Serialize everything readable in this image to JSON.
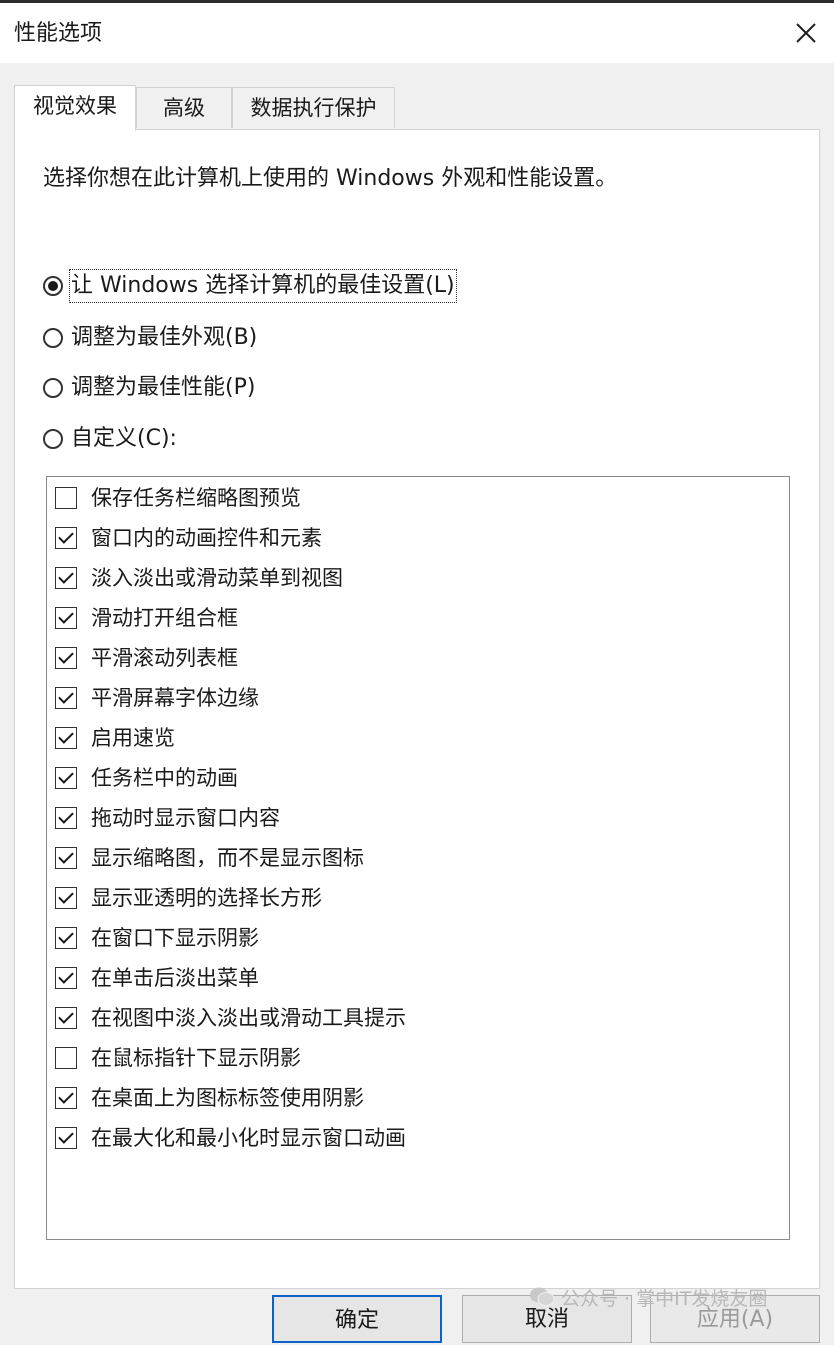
{
  "window": {
    "title": "性能选项"
  },
  "tabs": [
    {
      "label": "视觉效果",
      "active": true
    },
    {
      "label": "高级",
      "active": false
    },
    {
      "label": "数据执行保护",
      "active": false
    }
  ],
  "panel": {
    "instruction": "选择你想在此计算机上使用的 Windows 外观和性能设置。",
    "radios": [
      {
        "label": "让 Windows 选择计算机的最佳设置(L)",
        "selected": true
      },
      {
        "label": "调整为最佳外观(B)",
        "selected": false
      },
      {
        "label": "调整为最佳性能(P)",
        "selected": false
      },
      {
        "label": "自定义(C):",
        "selected": false
      }
    ],
    "options": [
      {
        "label": "保存任务栏缩略图预览",
        "checked": false
      },
      {
        "label": "窗口内的动画控件和元素",
        "checked": true
      },
      {
        "label": "淡入淡出或滑动菜单到视图",
        "checked": true
      },
      {
        "label": "滑动打开组合框",
        "checked": true
      },
      {
        "label": "平滑滚动列表框",
        "checked": true
      },
      {
        "label": "平滑屏幕字体边缘",
        "checked": true
      },
      {
        "label": "启用速览",
        "checked": true
      },
      {
        "label": "任务栏中的动画",
        "checked": true
      },
      {
        "label": "拖动时显示窗口内容",
        "checked": true
      },
      {
        "label": "显示缩略图，而不是显示图标",
        "checked": true
      },
      {
        "label": "显示亚透明的选择长方形",
        "checked": true
      },
      {
        "label": "在窗口下显示阴影",
        "checked": true
      },
      {
        "label": "在单击后淡出菜单",
        "checked": true
      },
      {
        "label": "在视图中淡入淡出或滑动工具提示",
        "checked": true
      },
      {
        "label": "在鼠标指针下显示阴影",
        "checked": false
      },
      {
        "label": "在桌面上为图标标签使用阴影",
        "checked": true
      },
      {
        "label": "在最大化和最小化时显示窗口动画",
        "checked": true
      }
    ]
  },
  "buttons": {
    "ok": "确定",
    "cancel": "取消",
    "apply": "应用(A)"
  },
  "watermark": {
    "text": "公众号 · 掌中IT发烧友圈"
  },
  "icons": {
    "close": "close-icon",
    "watermark": "wechat-icon"
  }
}
